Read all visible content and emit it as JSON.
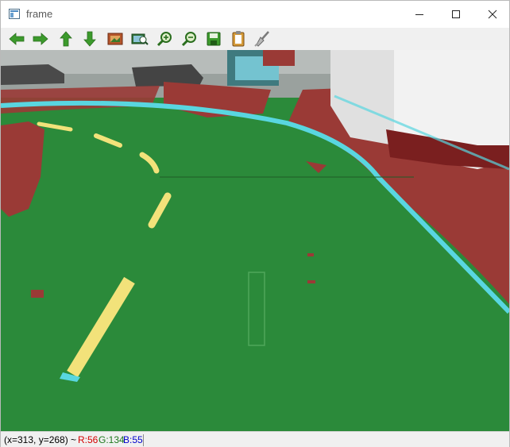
{
  "window": {
    "title": "frame"
  },
  "titlebar": {
    "minimize_icon": "minimize-icon",
    "maximize_icon": "maximize-icon",
    "close_icon": "close-icon"
  },
  "toolbar": {
    "buttons": [
      {
        "name": "pan-left-button",
        "icon": "arrow-left-icon"
      },
      {
        "name": "pan-right-button",
        "icon": "arrow-right-icon"
      },
      {
        "name": "pan-up-button",
        "icon": "arrow-up-icon"
      },
      {
        "name": "pan-down-button",
        "icon": "arrow-down-icon"
      },
      {
        "name": "zoom-fit-button",
        "icon": "image-fit-icon"
      },
      {
        "name": "zoom-original-button",
        "icon": "image-original-icon"
      },
      {
        "name": "zoom-in-button",
        "icon": "zoom-in-icon"
      },
      {
        "name": "zoom-out-button",
        "icon": "zoom-out-icon"
      },
      {
        "name": "save-button",
        "icon": "save-icon"
      },
      {
        "name": "copy-button",
        "icon": "clipboard-icon"
      },
      {
        "name": "properties-button",
        "icon": "brush-icon"
      }
    ]
  },
  "statusbar": {
    "coords": "(x=313, y=268) ~",
    "r": "R:56",
    "g": "G:134",
    "b": "B:55"
  },
  "colors": {
    "floor_green": "#2b8a3a",
    "segment_red": "#9a3a36",
    "lane_yellow": "#f2e27a",
    "edge_cyan": "#59d6e0",
    "toolbar_icon_green": "#3c9a2c"
  }
}
